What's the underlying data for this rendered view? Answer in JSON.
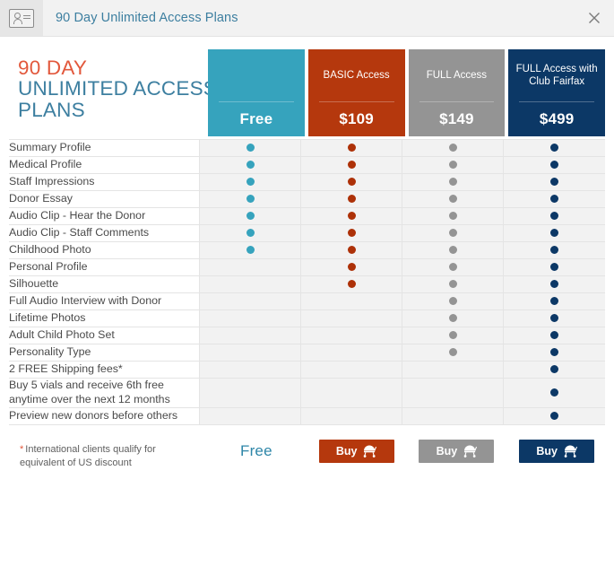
{
  "window": {
    "tab_icon": "contact-card-icon",
    "title": "90 Day Unlimited Access Plans",
    "close_icon": "close-icon"
  },
  "brand": {
    "line1": "90 DAY",
    "line2": "UNLIMITED ACCESS",
    "line3": "PLANS",
    "color_line1": "#e2583c",
    "color_line23": "#3d7fa0"
  },
  "plans": [
    {
      "name": "",
      "price": "Free",
      "color": "#36a3bd",
      "key": "free"
    },
    {
      "name": "BASIC Access",
      "price": "$109",
      "color": "#b5380d",
      "key": "basic"
    },
    {
      "name": "FULL Access",
      "price": "$149",
      "color": "#949494",
      "key": "full"
    },
    {
      "name": "FULL Access with Club Fairfax",
      "price": "$499",
      "color": "#0c3866",
      "key": "fairfax"
    }
  ],
  "features": [
    {
      "label": "Summary Profile",
      "included": [
        true,
        true,
        true,
        true
      ]
    },
    {
      "label": "Medical Profile",
      "included": [
        true,
        true,
        true,
        true
      ]
    },
    {
      "label": "Staff Impressions",
      "included": [
        true,
        true,
        true,
        true
      ]
    },
    {
      "label": "Donor Essay",
      "included": [
        true,
        true,
        true,
        true
      ]
    },
    {
      "label": "Audio Clip - Hear the Donor",
      "included": [
        true,
        true,
        true,
        true
      ]
    },
    {
      "label": "Audio Clip - Staff Comments",
      "included": [
        true,
        true,
        true,
        true
      ]
    },
    {
      "label": "Childhood Photo",
      "included": [
        true,
        true,
        true,
        true
      ]
    },
    {
      "label": "Personal Profile",
      "included": [
        false,
        true,
        true,
        true
      ]
    },
    {
      "label": "Silhouette",
      "included": [
        false,
        true,
        true,
        true
      ]
    },
    {
      "label": "Full Audio Interview with Donor",
      "included": [
        false,
        false,
        true,
        true
      ]
    },
    {
      "label": "Lifetime Photos",
      "included": [
        false,
        false,
        true,
        true
      ]
    },
    {
      "label": "Adult Child Photo Set",
      "included": [
        false,
        false,
        true,
        true
      ]
    },
    {
      "label": "Personality Type",
      "included": [
        false,
        false,
        true,
        true
      ]
    },
    {
      "label": "2 FREE Shipping fees*",
      "included": [
        false,
        false,
        false,
        true
      ]
    },
    {
      "label": "Buy 5 vials and receive 6th free anytime over the next 12 months",
      "included": [
        false,
        false,
        false,
        true
      ]
    },
    {
      "label": "Preview new donors before others",
      "included": [
        false,
        false,
        false,
        true
      ]
    }
  ],
  "footer": {
    "footnote_star": "*",
    "footnote_text": "International clients qualify for equivalent of US discount",
    "free_label": "Free",
    "buy_label": "Buy",
    "cart_icon": "stroller-icon"
  }
}
